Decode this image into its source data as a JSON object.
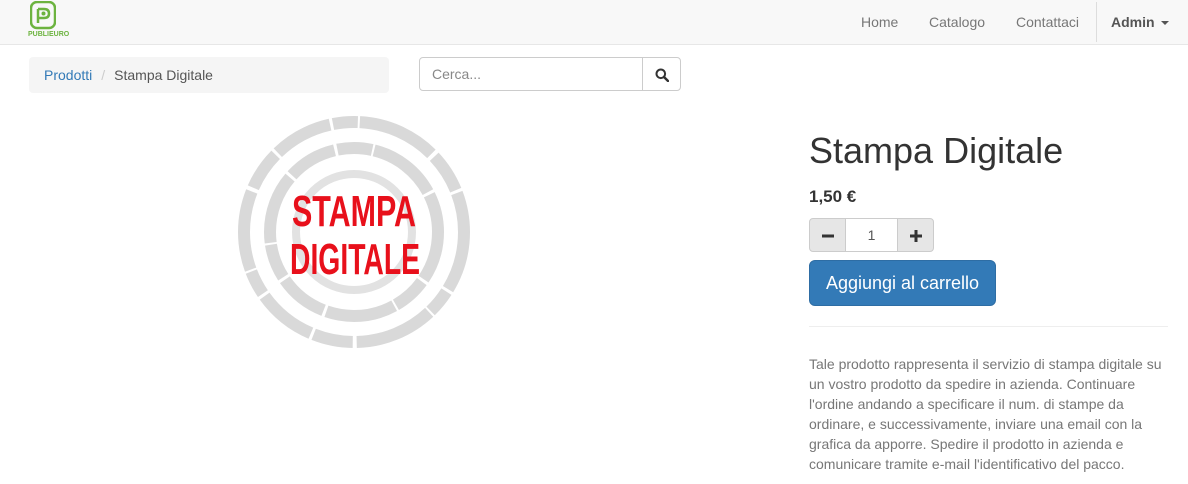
{
  "navbar": {
    "brand_text": "PUBLIEURO",
    "links": [
      {
        "label": "Home"
      },
      {
        "label": "Catalogo"
      },
      {
        "label": "Contattaci"
      }
    ],
    "user_label": "Admin"
  },
  "breadcrumb": {
    "root": "Prodotti",
    "current": "Stampa Digitale"
  },
  "search": {
    "placeholder": "Cerca..."
  },
  "product": {
    "image_text_line1": "STAMPA",
    "image_text_line2": "DIGITALE",
    "title": "Stampa Digitale",
    "price": "1,50 €",
    "quantity": "1",
    "add_to_cart_label": "Aggiungi al carrello",
    "description": "Tale prodotto rappresenta il servizio di stampa digitale su un vostro prodotto da spedire in azienda. Continuare l'ordine andando a specificare il num. di stampe da ordinare, e successivamente, inviare una email con la grafica da apporre. Spedire il prodotto in azienda e comunicare tramite e-mail l'identificativo del pacco."
  },
  "colors": {
    "brand_green": "#6cb33f",
    "primary_blue": "#337ab7",
    "stamp_red": "#e8101b",
    "ring_gray": "#d9d9d9"
  },
  "icons": {
    "search": "search-icon",
    "minus": "minus-icon",
    "plus": "plus-icon",
    "caret": "caret-down-icon"
  }
}
